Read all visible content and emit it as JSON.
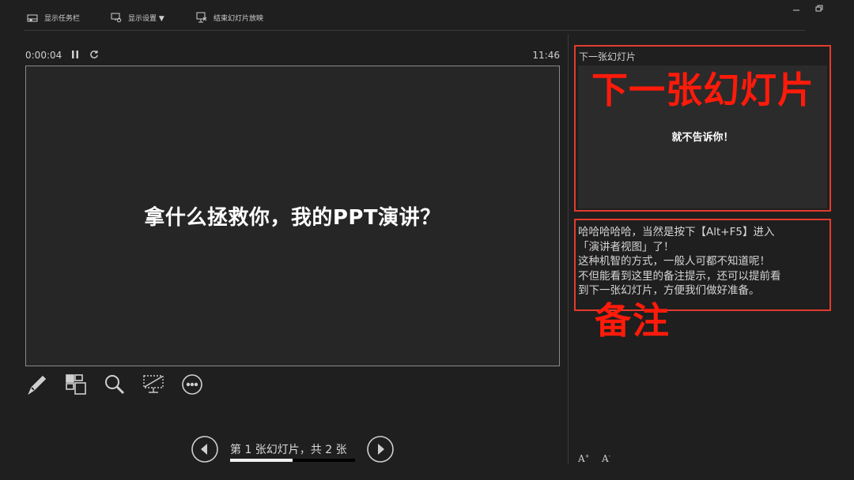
{
  "toolbar": {
    "taskbar_label": "显示任务栏",
    "display_settings_label": "显示设置 ▼",
    "end_show_label": "结束幻灯片放映"
  },
  "window_controls": [
    "minimize-icon",
    "restore-icon"
  ],
  "status": {
    "elapsed_time": "0:00:04",
    "clock": "11:46"
  },
  "current_slide": {
    "title": "拿什么拯救你，我的PPT演讲？"
  },
  "tools": [
    "pen-icon",
    "see-all-slides-icon",
    "zoom-icon",
    "black-screen-icon",
    "more-options-icon"
  ],
  "navigation": {
    "label": "第 1 张幻灯片，共 2 张",
    "current": 1,
    "total": 2
  },
  "next_slide": {
    "label": "下一张幻灯片",
    "preview_text": "就不告诉你！",
    "annotation": "下一张幻灯片"
  },
  "notes": {
    "lines": [
      "哈哈哈哈哈，当然是按下【Alt+F5】进入",
      "「演讲者视图」了！",
      "这种机智的方式，一般人可都不知道呢！",
      "不但能看到这里的备注提示，还可以提前看",
      "到下一张幻灯片，方便我们做好准备。"
    ],
    "annotation": "备注"
  },
  "font_controls": {
    "increase": "A",
    "decrease": "A"
  },
  "colors": {
    "background": "#1f1f1f",
    "annotation_red": "#ff1a0a",
    "box_border": "#e33b2e"
  }
}
